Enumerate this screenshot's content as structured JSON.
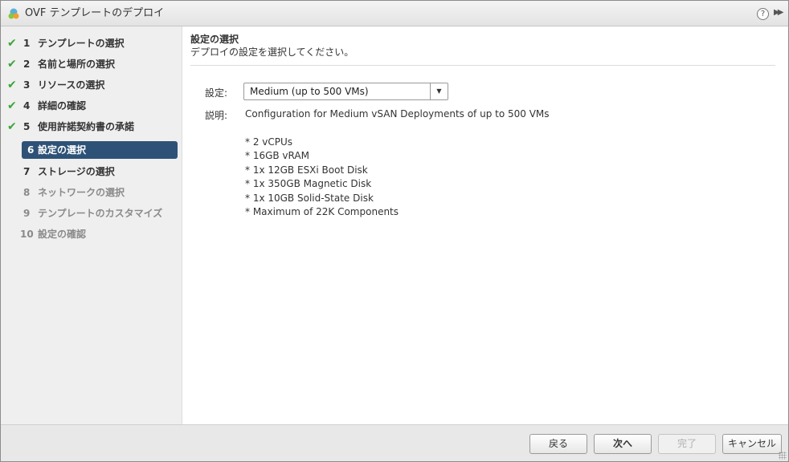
{
  "window": {
    "title": "OVF テンプレートのデプロイ",
    "help_glyph": "?",
    "expand_glyph": "▶▶"
  },
  "steps": [
    {
      "num": "1",
      "label": "テンプレートの選択",
      "state": "done"
    },
    {
      "num": "2",
      "label": "名前と場所の選択",
      "state": "done"
    },
    {
      "num": "3",
      "label": "リソースの選択",
      "state": "done"
    },
    {
      "num": "4",
      "label": "詳細の確認",
      "state": "done"
    },
    {
      "num": "5",
      "label": "使用許諾契約書の承諾",
      "state": "done"
    },
    {
      "num": "6",
      "label": "設定の選択",
      "state": "active"
    },
    {
      "num": "7",
      "label": "ストレージの選択",
      "state": "todo"
    },
    {
      "num": "8",
      "label": "ネットワークの選択",
      "state": "disabled"
    },
    {
      "num": "9",
      "label": "テンプレートのカスタマイズ",
      "state": "disabled"
    },
    {
      "num": "10",
      "label": "設定の確認",
      "state": "disabled"
    }
  ],
  "main": {
    "heading": "設定の選択",
    "subheading": "デプロイの設定を選択してください。",
    "config_label": "設定:",
    "config_value": "Medium (up to 500 VMs)",
    "desc_label": "説明:",
    "desc_intro": "Configuration for Medium vSAN Deployments of up to 500 VMs",
    "desc_items": [
      "* 2 vCPUs",
      "* 16GB vRAM",
      "* 1x 12GB ESXi Boot Disk",
      "* 1x 350GB Magnetic Disk",
      "* 1x 10GB Solid-State Disk",
      "* Maximum of 22K Components"
    ]
  },
  "footer": {
    "back": "戻る",
    "next": "次へ",
    "finish": "完了",
    "cancel": "キャンセル"
  },
  "colors": {
    "active_step": "#2e5277",
    "check": "#3aa53a"
  }
}
